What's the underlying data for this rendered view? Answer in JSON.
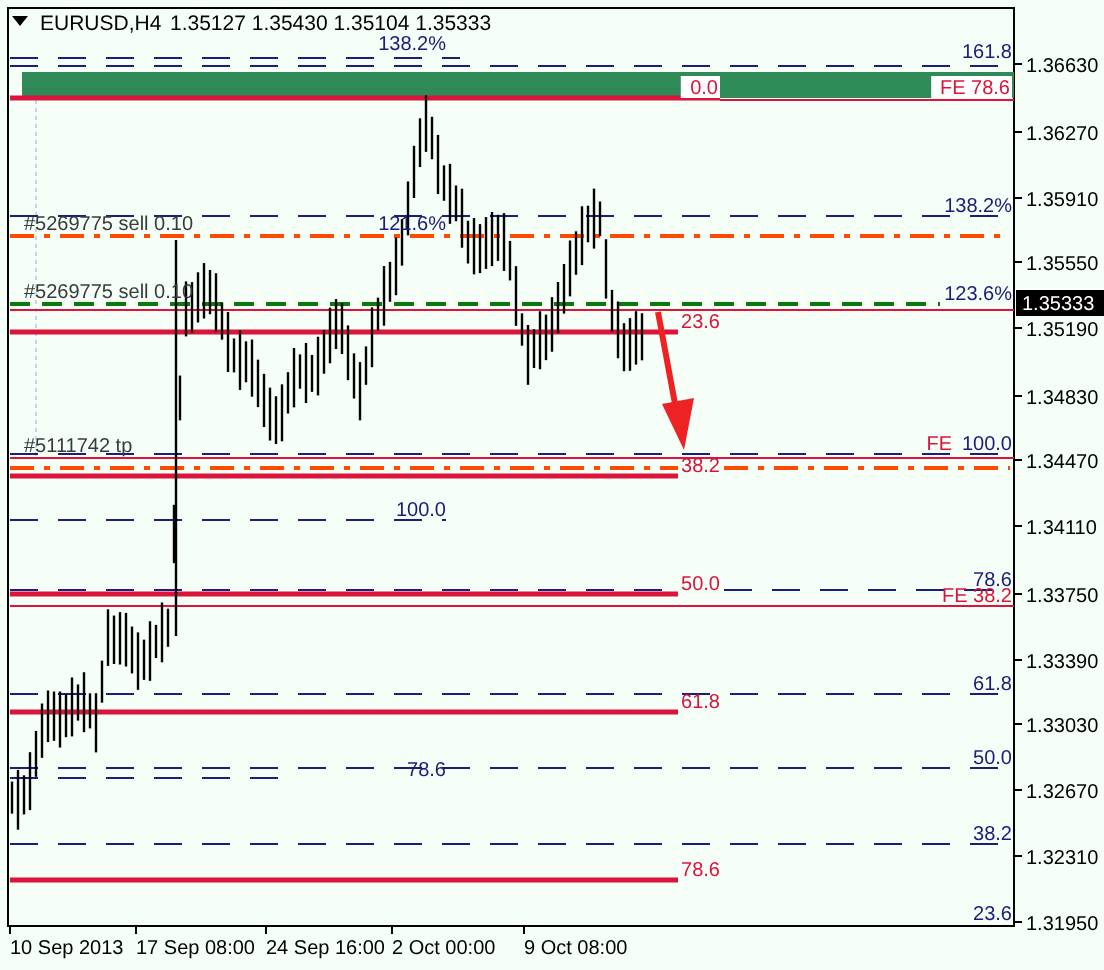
{
  "chart": {
    "symbol": "EURUSD,H4",
    "ohlc": "1.35127 1.35430 1.35104 1.35333",
    "price_axis": [
      "1.36630",
      "1.36270",
      "1.35910",
      "1.35550",
      "1.35190",
      "1.34830",
      "1.34470",
      "1.34110",
      "1.33750",
      "1.33390",
      "1.33030",
      "1.32670",
      "1.32310",
      "1.31950"
    ],
    "current_price": "1.35333",
    "time_axis": [
      "10 Sep 2013",
      "17 Sep 08:00",
      "24 Sep 16:00",
      "2 Oct 00:00",
      "9 Oct 08:00"
    ],
    "labels": [
      {
        "text": "138.2%",
        "kind": "fibo"
      },
      {
        "text": "161.8",
        "kind": "fibo"
      },
      {
        "text": "0.0",
        "kind": "fe"
      },
      {
        "text": "FE 78.6",
        "kind": "fe"
      },
      {
        "text": "#5269775 sell 0.10",
        "kind": "order"
      },
      {
        "text": "121.6%",
        "kind": "fibo"
      },
      {
        "text": "138.2%",
        "kind": "fibo"
      },
      {
        "text": "#5269775 sell 0.10",
        "kind": "order"
      },
      {
        "text": "123.6%",
        "kind": "fibo"
      },
      {
        "text": "23.6",
        "kind": "fe"
      },
      {
        "text": "#5111742 tp",
        "kind": "order"
      },
      {
        "text": "FE",
        "kind": "fe"
      },
      {
        "text": "100.0",
        "kind": "fibo"
      },
      {
        "text": "38.2",
        "kind": "fe"
      },
      {
        "text": "100.0",
        "kind": "fibo"
      },
      {
        "text": "50.0",
        "kind": "fe"
      },
      {
        "text": "78.6",
        "kind": "fibo"
      },
      {
        "text": "FE 38.2",
        "kind": "fe"
      },
      {
        "text": "61.8",
        "kind": "fibo"
      },
      {
        "text": "61.8",
        "kind": "fe"
      },
      {
        "text": "78.6",
        "kind": "fibo"
      },
      {
        "text": "50.0",
        "kind": "fibo"
      },
      {
        "text": "38.2",
        "kind": "fibo"
      },
      {
        "text": "78.6",
        "kind": "fe"
      },
      {
        "text": "23.6",
        "kind": "fibo"
      }
    ]
  }
}
